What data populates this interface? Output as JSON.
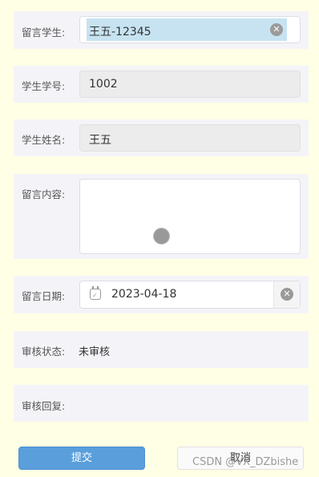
{
  "form": {
    "student": {
      "label": "留言学生:",
      "value": "王五-12345"
    },
    "student_no": {
      "label": "学生学号:",
      "value": "1002"
    },
    "student_name": {
      "label": "学生姓名:",
      "value": "王五"
    },
    "content": {
      "label": "留言内容:",
      "value": ""
    },
    "date": {
      "label": "留言日期:",
      "value": "2023-04-18"
    },
    "status": {
      "label": "审核状态:",
      "value": "未审核"
    },
    "reply": {
      "label": "审核回复:",
      "value": ""
    }
  },
  "actions": {
    "submit_label": "提交",
    "cancel_label": "取消"
  },
  "watermark": "CSDN @VX_DZbishe",
  "icons": {
    "clear": "clear-circle-icon",
    "calendar": "calendar-icon"
  },
  "colors": {
    "background": "#ffffe6",
    "primary": "#5a9fdc",
    "selection": "#c7e3f1"
  }
}
